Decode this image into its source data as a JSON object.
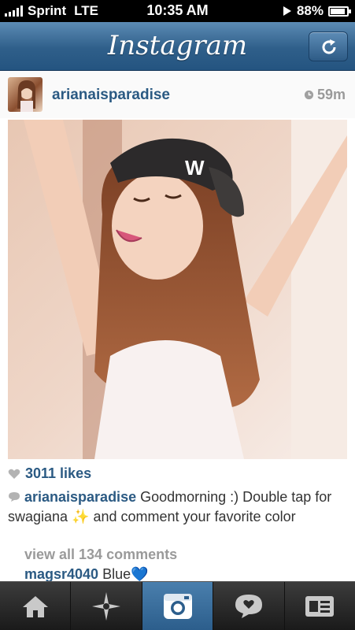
{
  "status_bar": {
    "carrier": "Sprint",
    "network": "LTE",
    "time": "10:35 AM",
    "battery": "88%",
    "battery_level": 0.88
  },
  "nav": {
    "title": "Instagram"
  },
  "post": {
    "username": "arianaisparadise",
    "time_ago": "59m",
    "likes": "3011 likes",
    "caption_user": "arianaisparadise",
    "caption_text": "Goodmorning :) Double tap for swagiana ✨ and comment your favorite color",
    "view_all": "view all 134 comments",
    "comment": {
      "user": "magsr4040",
      "text": "Blue💙"
    }
  },
  "tab_bar": {
    "tabs": [
      {
        "icon": "home-icon",
        "active": false
      },
      {
        "icon": "explore-star-icon",
        "active": false
      },
      {
        "icon": "camera-icon",
        "active": true
      },
      {
        "icon": "news-speech-bubble-icon",
        "active": false
      },
      {
        "icon": "profile-card-icon",
        "active": false
      }
    ]
  },
  "colors": {
    "nav_blue": "#2f5f8a",
    "link_blue": "#2b5a83",
    "active_tab": "#3a6e9c"
  }
}
